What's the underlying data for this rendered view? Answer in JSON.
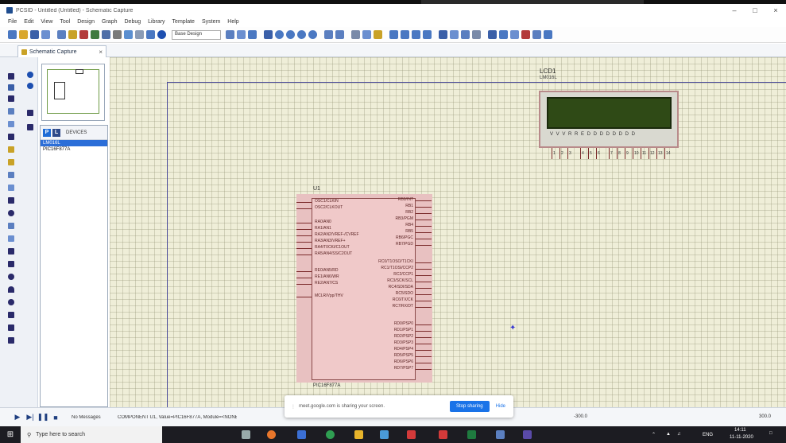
{
  "window": {
    "title": "PCSID - Untitled (Untitled) - Schematic Capture",
    "minimize": "–",
    "maximize": "□",
    "close": "×"
  },
  "menu": [
    "File",
    "Edit",
    "View",
    "Tool",
    "Design",
    "Graph",
    "Debug",
    "Library",
    "Template",
    "System",
    "Help"
  ],
  "toolbar": {
    "design_select": "Base Design"
  },
  "tab": {
    "label": "Schematic Capture",
    "close": "×"
  },
  "devices": {
    "pick_label": "P",
    "library_label": "L",
    "title": "DEVICES",
    "items": [
      "LM016L",
      "PIC16F877A"
    ],
    "selected_index": 0
  },
  "lcd": {
    "ref": "LCD1",
    "type": "LM016L",
    "pins": [
      "VSS",
      "VDD",
      "VEE",
      "RS",
      "RW",
      "E",
      "D0",
      "D1",
      "D2",
      "D3",
      "D4",
      "D5",
      "D6",
      "D7"
    ],
    "pin_numbers": [
      "1",
      "2",
      "3",
      "4",
      "5",
      "6",
      "7",
      "8",
      "9",
      "10",
      "11",
      "12",
      "13",
      "14"
    ]
  },
  "mcu": {
    "ref": "U1",
    "type": "PIC16F877A",
    "left_pins": [
      "OSC1/CLKIN",
      "OSC2/CLKOUT",
      "RA0/AN0",
      "RA1/AN1",
      "RA2/AN2/VREF-/CVREF",
      "RA3/AN3/VREF+",
      "RA4/T0CKI/C1OUT",
      "RA5/AN4/SS/C2OUT",
      "RE0/AN5/RD",
      "RE1/AN6/WR",
      "RE2/AN7/CS",
      "MCLR/Vpp/THV"
    ],
    "right_pins": [
      "RB0/INT",
      "RB1",
      "RB2",
      "RB3/PGM",
      "RB4",
      "RB5",
      "RB6/PGC",
      "RB7/PGD",
      "RC0/T1OSO/T1CKI",
      "RC1/T1OSI/CCP2",
      "RC2/CCP1",
      "RC3/SCK/SCL",
      "RC4/SDI/SDA",
      "RC5/SDO",
      "RC6/TX/CK",
      "RC7/RX/DT",
      "RD0/PSP0",
      "RD1/PSP1",
      "RD2/PSP2",
      "RD3/PSP3",
      "RD4/PSP4",
      "RD5/PSP5",
      "RD6/PSP6",
      "RD7/PSP7"
    ]
  },
  "status": {
    "messages": "No Messages",
    "component": "COMPONENT U1, Value=PIC16F877A, Module=<NONE>, Device=PIC16F877A",
    "coord_x": "-300.0",
    "coord_y": "300.0"
  },
  "share": {
    "message": "meet.google.com is sharing your screen.",
    "stop": "Stop sharing",
    "hide": "Hide"
  },
  "taskbar": {
    "search_placeholder": "Type here to search",
    "time": "14:11",
    "date": "11-11-2020",
    "lang": "ENG"
  }
}
